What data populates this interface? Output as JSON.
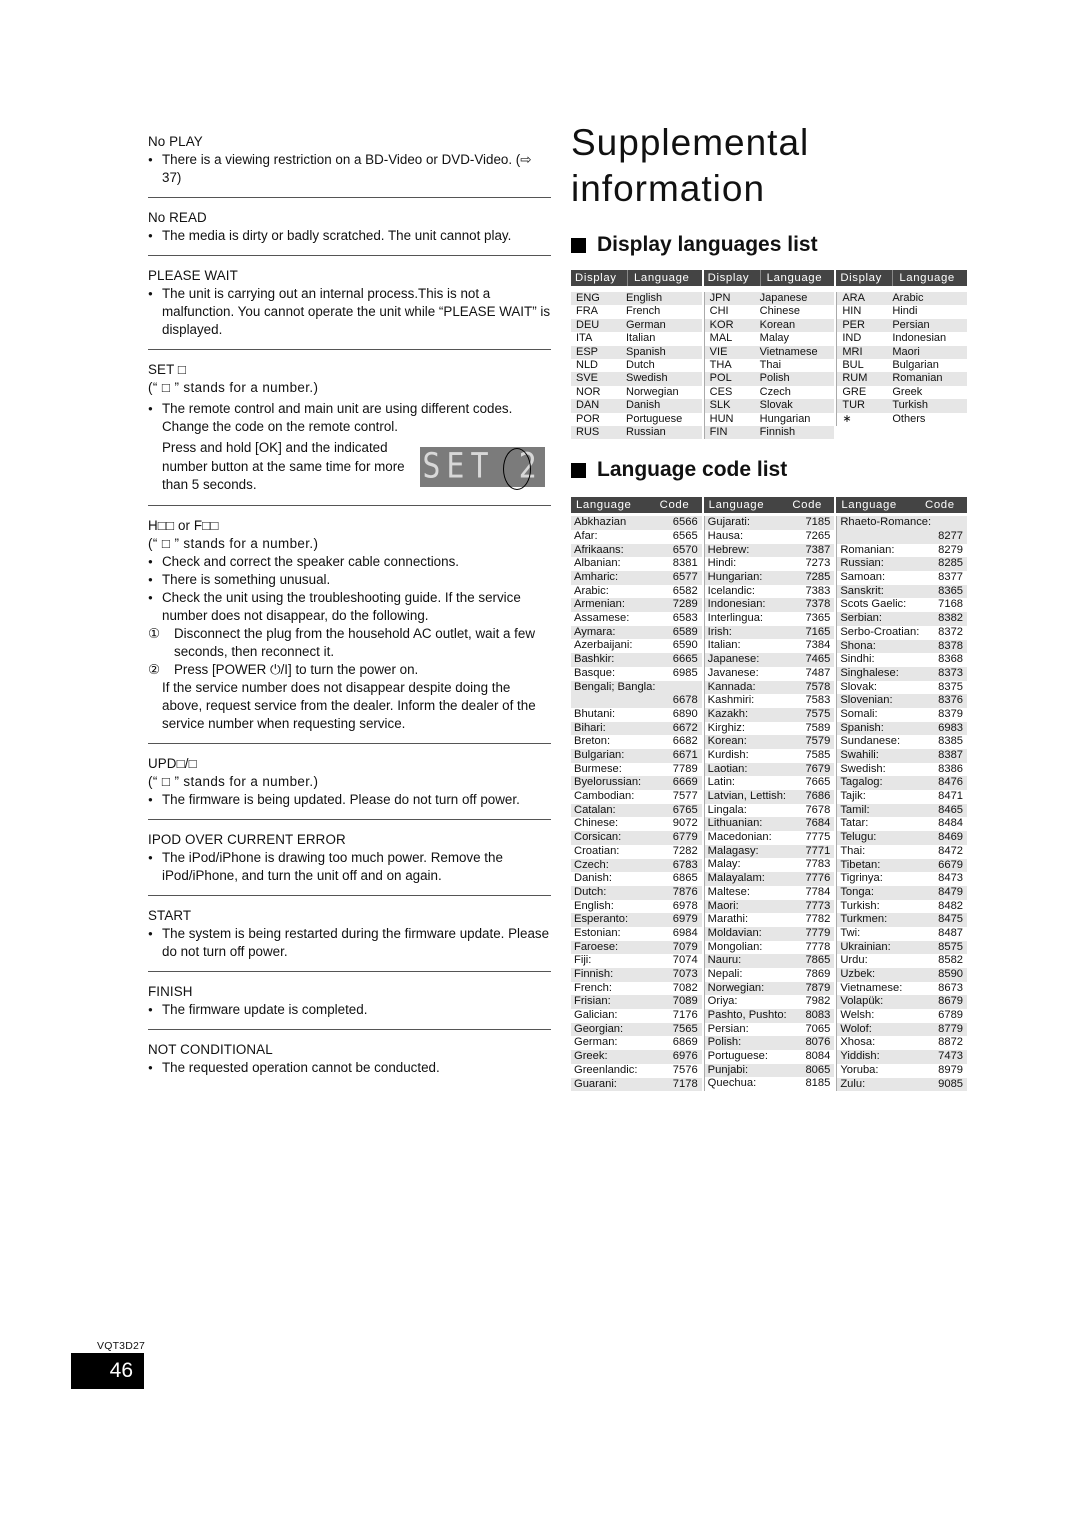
{
  "left_sections": [
    {
      "title": "No PLAY",
      "note": null,
      "bullets": [
        "There is a viewing restriction on a BD-Video or DVD-Video. (⇨ 37)"
      ]
    },
    {
      "title": "No READ",
      "note": null,
      "bullets": [
        "The media is dirty or badly scratched. The unit cannot play."
      ]
    },
    {
      "title": "PLEASE WAIT",
      "note": null,
      "bullets": [
        "The unit is carrying out an internal process.This is not a malfunction. You cannot operate the unit while “PLEASE WAIT” is displayed."
      ]
    },
    {
      "title": "SET □",
      "note": "(“ □ ” stands for a number.)",
      "bullets": [
        "The remote control and main unit are using different codes. Change the code on the remote control."
      ],
      "extra": "Press and hold [OK] and the indicated number button at the same time for more than 5 seconds.",
      "display_text": "SET",
      "display_digit": "2"
    },
    {
      "title": "H□□ or F□□",
      "note": "(“ □ ” stands for a number.)",
      "bullets": [
        "Check and correct the speaker cable connections.",
        "There is something unusual.",
        "Check the unit using the troubleshooting guide. If the service number does not disappear, do the following."
      ],
      "steps": [
        {
          "num": "①",
          "text": "Disconnect the plug from the household AC outlet, wait a few seconds, then reconnect it."
        },
        {
          "num": "②",
          "text": "Press [POWER ⏻/I] to turn the power on."
        }
      ],
      "extra": "If the service number does not disappear despite doing the above, request service from the dealer. Inform the dealer of the service number when requesting service."
    },
    {
      "title": "UPD□/□",
      "note": "(“ □ ” stands for a number.)",
      "bullets": [
        "The firmware is being updated. Please do not turn off power."
      ]
    },
    {
      "title": "IPOD OVER CURRENT ERROR",
      "note": null,
      "bullets": [
        "The iPod/iPhone is drawing too much power. Remove the iPod/iPhone, and turn the unit off and on again."
      ]
    },
    {
      "title": "START",
      "note": null,
      "bullets": [
        "The system is being restarted during the firmware update. Please do not turn off power."
      ]
    },
    {
      "title": "FINISH",
      "note": null,
      "bullets": [
        "The firmware update is completed."
      ]
    },
    {
      "title": "NOT CONDITIONAL",
      "note": null,
      "bullets": [
        "The requested operation cannot be conducted."
      ]
    }
  ],
  "page_title_line1": "Supplemental",
  "page_title_line2": "information",
  "display_languages": {
    "heading": "Display languages list",
    "col_display": "Display",
    "col_language": "Language",
    "columns": [
      [
        [
          "ENG",
          "English"
        ],
        [
          "FRA",
          "French"
        ],
        [
          "DEU",
          "German"
        ],
        [
          "ITA",
          "Italian"
        ],
        [
          "ESP",
          "Spanish"
        ],
        [
          "NLD",
          "Dutch"
        ],
        [
          "SVE",
          "Swedish"
        ],
        [
          "NOR",
          "Norwegian"
        ],
        [
          "DAN",
          "Danish"
        ],
        [
          "POR",
          "Portuguese"
        ],
        [
          "RUS",
          "Russian"
        ]
      ],
      [
        [
          "JPN",
          "Japanese"
        ],
        [
          "CHI",
          "Chinese"
        ],
        [
          "KOR",
          "Korean"
        ],
        [
          "MAL",
          "Malay"
        ],
        [
          "VIE",
          "Vietnamese"
        ],
        [
          "THA",
          "Thai"
        ],
        [
          "POL",
          "Polish"
        ],
        [
          "CES",
          "Czech"
        ],
        [
          "SLK",
          "Slovak"
        ],
        [
          "HUN",
          "Hungarian"
        ],
        [
          "FIN",
          "Finnish"
        ]
      ],
      [
        [
          "ARA",
          "Arabic"
        ],
        [
          "HIN",
          "Hindi"
        ],
        [
          "PER",
          "Persian"
        ],
        [
          "IND",
          "Indonesian"
        ],
        [
          "MRI",
          "Maori"
        ],
        [
          "BUL",
          "Bulgarian"
        ],
        [
          "RUM",
          "Romanian"
        ],
        [
          "GRE",
          "Greek"
        ],
        [
          "TUR",
          "Turkish"
        ],
        [
          "∗",
          "Others"
        ]
      ]
    ]
  },
  "language_codes": {
    "heading": "Language code list",
    "col_language": "Language",
    "col_code": "Code",
    "columns": [
      [
        [
          "Abkhazian",
          "6566"
        ],
        [
          "Afar:",
          "6565"
        ],
        [
          "Afrikaans:",
          "6570"
        ],
        [
          "Albanian:",
          "8381"
        ],
        [
          "Amharic:",
          "6577"
        ],
        [
          "Arabic:",
          "6582"
        ],
        [
          "Armenian:",
          "7289"
        ],
        [
          "Assamese:",
          "6583"
        ],
        [
          "Aymara:",
          "6589"
        ],
        [
          "Azerbaijani:",
          "6590"
        ],
        [
          "Bashkir:",
          "6665"
        ],
        [
          "Basque:",
          "6985"
        ],
        [
          "Bengali; Bangla:",
          "6678"
        ],
        [
          "Bhutani:",
          "6890"
        ],
        [
          "Bihari:",
          "6672"
        ],
        [
          "Breton:",
          "6682"
        ],
        [
          "Bulgarian:",
          "6671"
        ],
        [
          "Burmese:",
          "7789"
        ],
        [
          "Byelorussian:",
          "6669"
        ],
        [
          "Cambodian:",
          "7577"
        ],
        [
          "Catalan:",
          "6765"
        ],
        [
          "Chinese:",
          "9072"
        ],
        [
          "Corsican:",
          "6779"
        ],
        [
          "Croatian:",
          "7282"
        ],
        [
          "Czech:",
          "6783"
        ],
        [
          "Danish:",
          "6865"
        ],
        [
          "Dutch:",
          "7876"
        ],
        [
          "English:",
          "6978"
        ],
        [
          "Esperanto:",
          "6979"
        ],
        [
          "Estonian:",
          "6984"
        ],
        [
          "Faroese:",
          "7079"
        ],
        [
          "Fiji:",
          "7074"
        ],
        [
          "Finnish:",
          "7073"
        ],
        [
          "French:",
          "7082"
        ],
        [
          "Frisian:",
          "7089"
        ],
        [
          "Galician:",
          "7176"
        ],
        [
          "Georgian:",
          "7565"
        ],
        [
          "German:",
          "6869"
        ],
        [
          "Greek:",
          "6976"
        ],
        [
          "Greenlandic:",
          "7576"
        ],
        [
          "Guarani:",
          "7178"
        ]
      ],
      [
        [
          "Gujarati:",
          "7185"
        ],
        [
          "Hausa:",
          "7265"
        ],
        [
          "Hebrew:",
          "7387"
        ],
        [
          "Hindi:",
          "7273"
        ],
        [
          "Hungarian:",
          "7285"
        ],
        [
          "Icelandic:",
          "7383"
        ],
        [
          "Indonesian:",
          "7378"
        ],
        [
          "Interlingua:",
          "7365"
        ],
        [
          "Irish:",
          "7165"
        ],
        [
          "Italian:",
          "7384"
        ],
        [
          "Japanese:",
          "7465"
        ],
        [
          "Javanese:",
          "7487"
        ],
        [
          "Kannada:",
          "7578"
        ],
        [
          "Kashmiri:",
          "7583"
        ],
        [
          "Kazakh:",
          "7575"
        ],
        [
          "Kirghiz:",
          "7589"
        ],
        [
          "Korean:",
          "7579"
        ],
        [
          "Kurdish:",
          "7585"
        ],
        [
          "Laotian:",
          "7679"
        ],
        [
          "Latin:",
          "7665"
        ],
        [
          "Latvian, Lettish:",
          "7686"
        ],
        [
          "Lingala:",
          "7678"
        ],
        [
          "Lithuanian:",
          "7684"
        ],
        [
          "Macedonian:",
          "7775"
        ],
        [
          "Malagasy:",
          "7771"
        ],
        [
          "Malay:",
          "7783"
        ],
        [
          "Malayalam:",
          "7776"
        ],
        [
          "Maltese:",
          "7784"
        ],
        [
          "Maori:",
          "7773"
        ],
        [
          "Marathi:",
          "7782"
        ],
        [
          "Moldavian:",
          "7779"
        ],
        [
          "Mongolian:",
          "7778"
        ],
        [
          "Nauru:",
          "7865"
        ],
        [
          "Nepali:",
          "7869"
        ],
        [
          "Norwegian:",
          "7879"
        ],
        [
          "Oriya:",
          "7982"
        ],
        [
          "Pashto, Pushto:",
          "8083"
        ],
        [
          "Persian:",
          "7065"
        ],
        [
          "Polish:",
          "8076"
        ],
        [
          "Portuguese:",
          "8084"
        ],
        [
          "Punjabi:",
          "8065"
        ],
        [
          "Quechua:",
          "8185"
        ]
      ],
      [
        [
          "Rhaeto-Romance:",
          "8277"
        ],
        [
          "Romanian:",
          "8279"
        ],
        [
          "Russian:",
          "8285"
        ],
        [
          "Samoan:",
          "8377"
        ],
        [
          "Sanskrit:",
          "8365"
        ],
        [
          "Scots Gaelic:",
          "7168"
        ],
        [
          "Serbian:",
          "8382"
        ],
        [
          "Serbo-Croatian:",
          "8372"
        ],
        [
          "Shona:",
          "8378"
        ],
        [
          "Sindhi:",
          "8368"
        ],
        [
          "Singhalese:",
          "8373"
        ],
        [
          "Slovak:",
          "8375"
        ],
        [
          "Slovenian:",
          "8376"
        ],
        [
          "Somali:",
          "8379"
        ],
        [
          "Spanish:",
          "6983"
        ],
        [
          "Sundanese:",
          "8385"
        ],
        [
          "Swahili:",
          "8387"
        ],
        [
          "Swedish:",
          "8386"
        ],
        [
          "Tagalog:",
          "8476"
        ],
        [
          "Tajik:",
          "8471"
        ],
        [
          "Tamil:",
          "8465"
        ],
        [
          "Tatar:",
          "8484"
        ],
        [
          "Telugu:",
          "8469"
        ],
        [
          "Thai:",
          "8472"
        ],
        [
          "Tibetan:",
          "6679"
        ],
        [
          "Tigrinya:",
          "8473"
        ],
        [
          "Tonga:",
          "8479"
        ],
        [
          "Turkish:",
          "8482"
        ],
        [
          "Turkmen:",
          "8475"
        ],
        [
          "Twi:",
          "8487"
        ],
        [
          "Ukrainian:",
          "8575"
        ],
        [
          "Urdu:",
          "8582"
        ],
        [
          "Uzbek:",
          "8590"
        ],
        [
          "Vietnamese:",
          "8673"
        ],
        [
          "Volapük:",
          "8679"
        ],
        [
          "Welsh:",
          "6789"
        ],
        [
          "Wolof:",
          "8779"
        ],
        [
          "Xhosa:",
          "8872"
        ],
        [
          "Yiddish:",
          "7473"
        ],
        [
          "Yoruba:",
          "8979"
        ],
        [
          "Zulu:",
          "9085"
        ]
      ]
    ],
    "wrapped_entries": [
      "Bengali; Bangla:",
      "Rhaeto-Romance:"
    ]
  },
  "footer": {
    "doc_code": "VQT3D27",
    "page_number": "46"
  }
}
